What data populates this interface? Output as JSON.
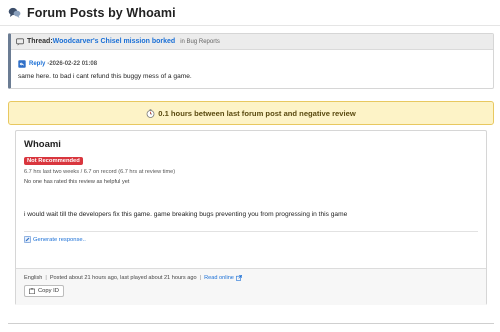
{
  "page": {
    "title": "Forum Posts by Whoami",
    "title_icon": "forum-bubbles-icon"
  },
  "thread": {
    "label": "Thread:",
    "title": "Woodcarver's Chisel mission borked",
    "section": "in Bug Reports",
    "icon": "speech-bubble-icon"
  },
  "reply": {
    "label": "Reply",
    "date": "-2026-02-22 01:08",
    "icon": "reply-arrow-icon",
    "text": "same here. to bad i cant refund this buggy mess of a game."
  },
  "alert": {
    "icon": "stopwatch-icon",
    "text": "0.1 hours between last forum post and negative review",
    "bg_color": "#fdf3c7",
    "border_color": "#e8c860"
  },
  "review": {
    "author": "Whoami",
    "verdict": "Not Recommended",
    "verdict_color": "#d9363e",
    "playtime": "6.7 hrs last two weeks / 6.7 on record (6.7 hrs at review time)",
    "helpful": "No one has rated this review as helpful yet",
    "body": "i would wait till the developers fix this game. game breaking bugs preventing you from progressing in this game",
    "generate_label": "Generate response..",
    "generate_icon": "pencil-icon"
  },
  "footer": {
    "language": "English",
    "posted": "Posted about 21 hours ago, last played about 21 hours ago",
    "read_online": "Read online",
    "external_icon": "external-link-icon",
    "copy_label": "Copy ID",
    "copy_icon": "clipboard-icon"
  },
  "colors": {
    "link": "#1a6fd6",
    "accent_border": "#6b7c93"
  }
}
